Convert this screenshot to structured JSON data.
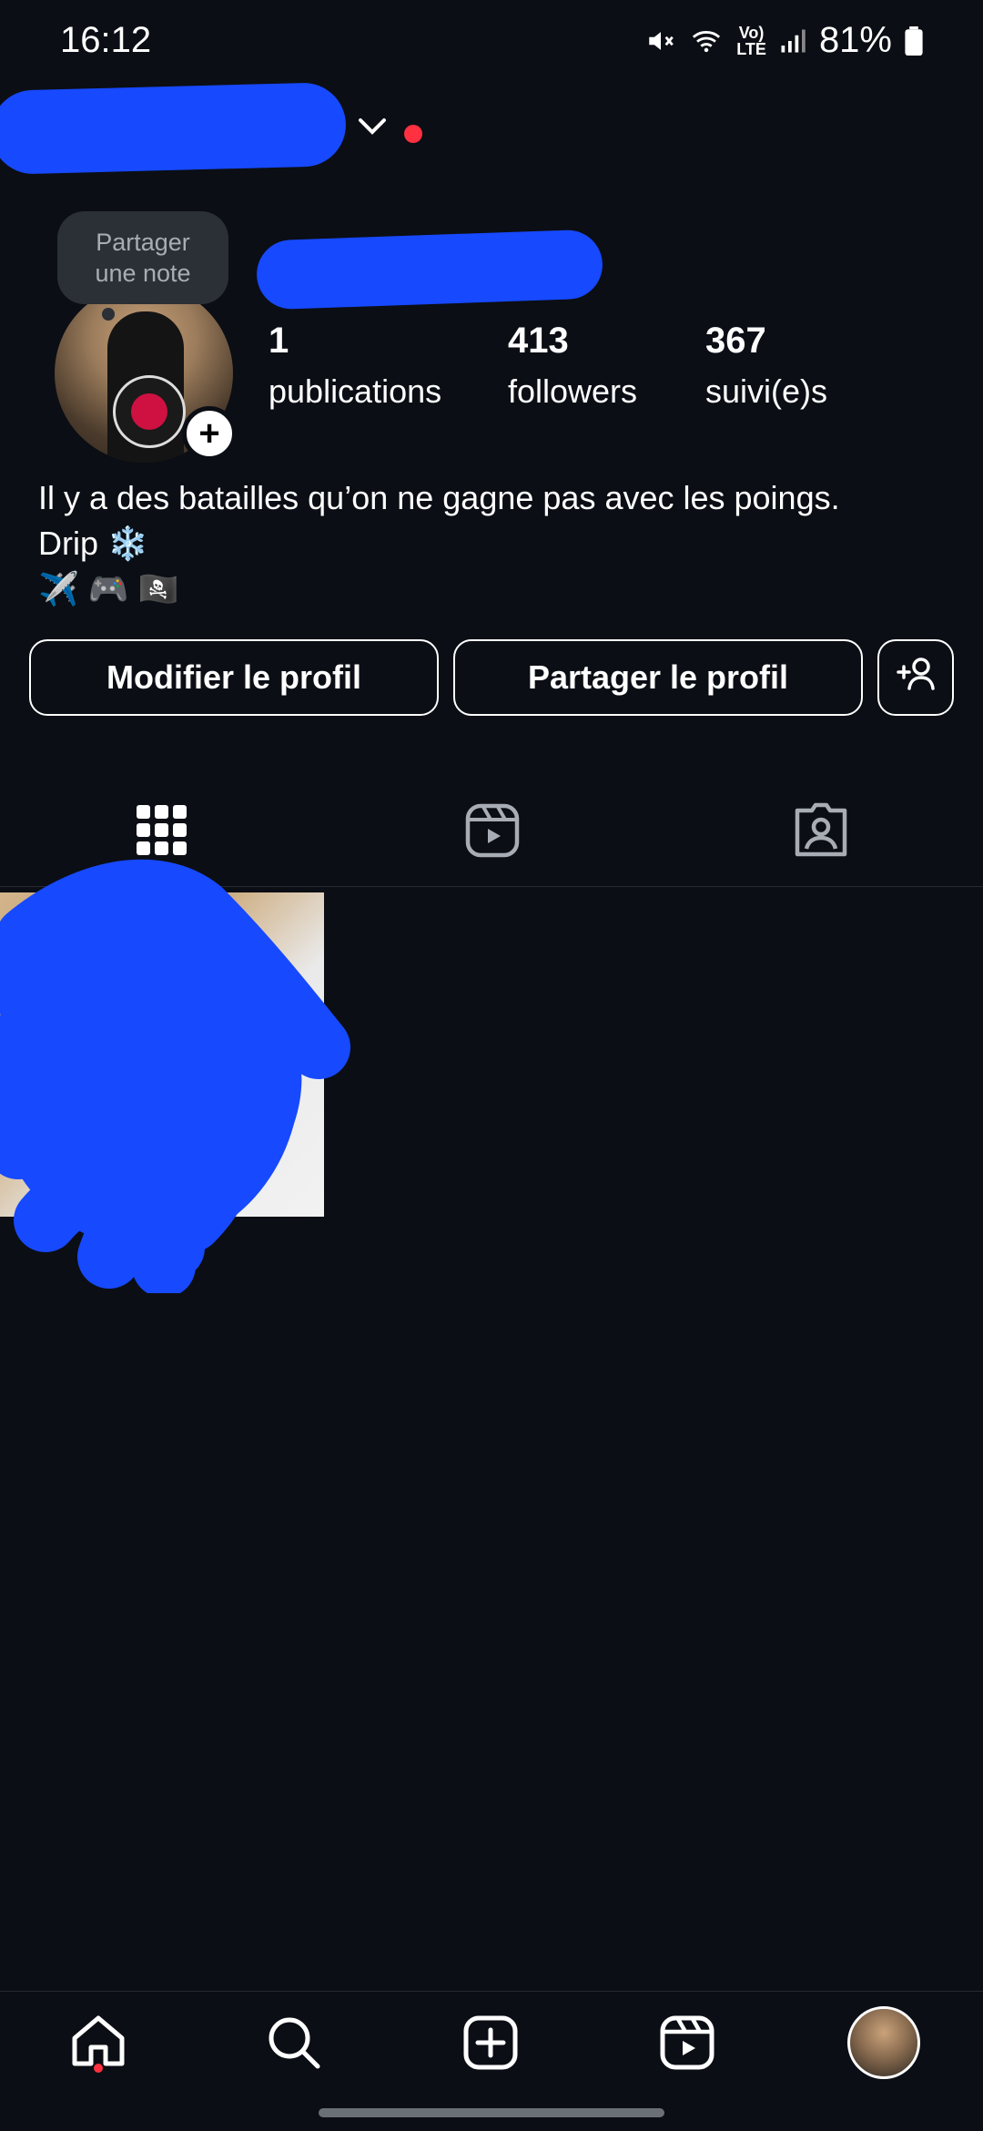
{
  "status_bar": {
    "time": "16:12",
    "battery": "81%",
    "icons": [
      "mute-icon",
      "wifi-icon",
      "volte-icon",
      "signal-icon",
      "battery-icon"
    ]
  },
  "profile": {
    "note_bubble": {
      "line1": "Partager",
      "line2": "une note"
    },
    "stats": [
      {
        "count": "1",
        "label": "publications"
      },
      {
        "count": "413",
        "label": "followers"
      },
      {
        "count": "367",
        "label": "suivi(e)s"
      }
    ],
    "bio": [
      "Il y a des batailles qu’on ne gagne pas avec les poings.",
      "Drip ❄️",
      "✈️ 🎮 🏴‍☠️"
    ]
  },
  "actions": {
    "edit_profile": "Modifier le profil",
    "share_profile": "Partager le profil"
  },
  "tabs": [
    {
      "name": "grid",
      "icon": "grid-icon",
      "active": true
    },
    {
      "name": "reels",
      "icon": "reels-icon",
      "active": false
    },
    {
      "name": "tagged",
      "icon": "tagged-icon",
      "active": false
    }
  ],
  "colors": {
    "background": "#0b0e14",
    "redaction": "#1749ff",
    "notification": "#ff3040",
    "note_bg": "#2b2f36"
  },
  "bottom_nav": [
    "home-icon",
    "search-icon",
    "create-icon",
    "reels-icon",
    "profile-avatar"
  ]
}
